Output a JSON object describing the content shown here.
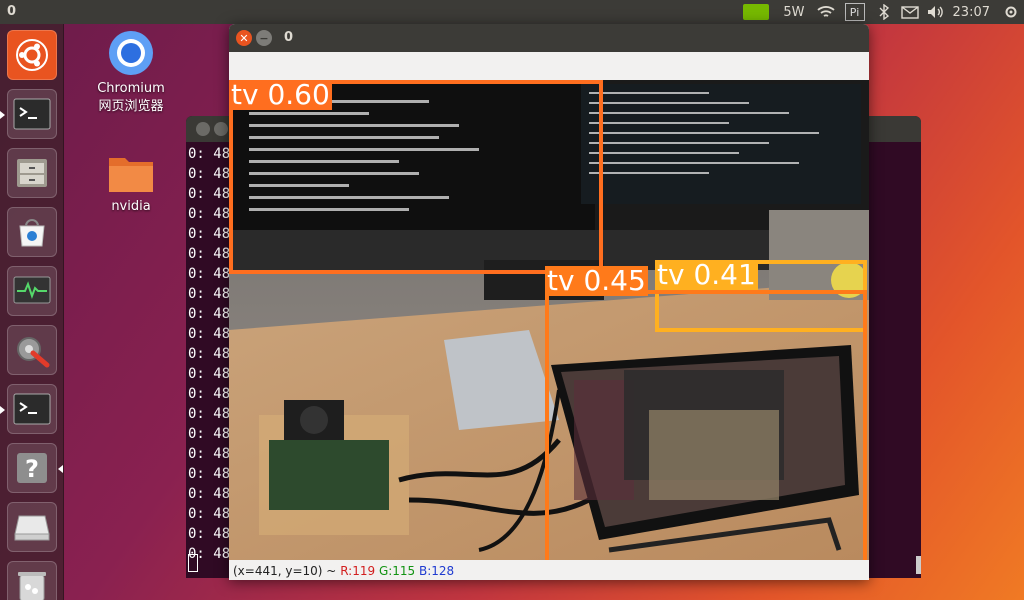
{
  "top_panel": {
    "title": "0",
    "power": "5W",
    "pi_label": "Pi",
    "time": "23:07"
  },
  "launcher": {
    "items": [
      "ubuntu-logo-icon",
      "terminal-icon",
      "files-icon",
      "software-center-icon",
      "system-monitor-icon",
      "settings-icon",
      "terminal-icon",
      "help-icon",
      "drive-icon",
      "trash-icon"
    ]
  },
  "desktop": {
    "icons": [
      {
        "label1": "Chromium",
        "label2": "网页浏览器",
        "icon": "chromium-icon"
      },
      {
        "label1": "nvidia",
        "icon": "folder-icon"
      }
    ]
  },
  "terminal": {
    "lines": [
      "0: 48",
      "0: 48",
      "0: 48",
      "0: 48",
      "0: 48",
      "0: 48",
      "0: 48",
      "0: 48",
      "0: 48",
      "0: 48",
      "0: 48",
      "0: 48",
      "0: 48",
      "0: 48",
      "0: 48",
      "0: 48",
      "0: 48",
      "0: 48",
      "0: 48",
      "0: 48",
      "0: 48"
    ]
  },
  "viewer": {
    "title": "0",
    "status": {
      "coords": "(x=441, y=10) ~",
      "r": "R:119",
      "g": "G:115",
      "b": "B:128"
    }
  },
  "detections": [
    {
      "label": "tv 0.60",
      "color": "#ff6e1f"
    },
    {
      "label": "tv 0.45",
      "color": "#ff7a1a"
    },
    {
      "label": "tv 0.41",
      "color": "#ffb020"
    }
  ]
}
